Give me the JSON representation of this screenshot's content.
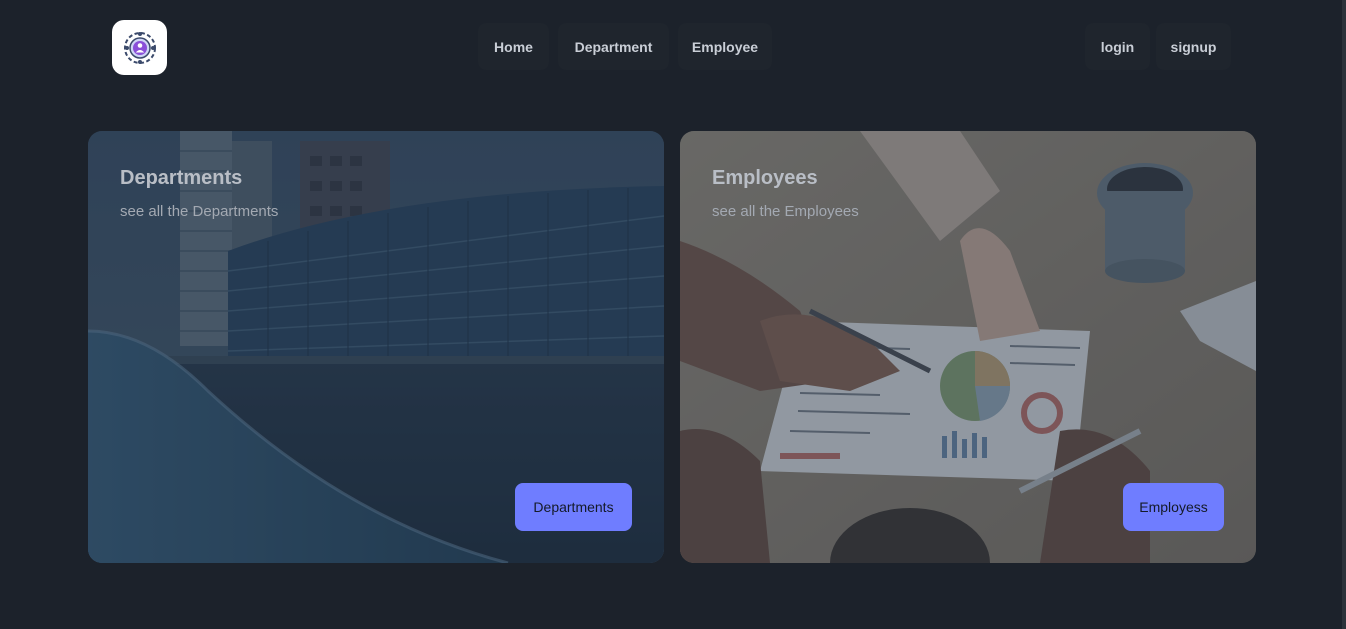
{
  "header": {
    "logo_icon": "gear-people-logo-icon",
    "nav": [
      {
        "label": "Home"
      },
      {
        "label": "Department"
      },
      {
        "label": "Employee"
      }
    ],
    "auth": {
      "login_label": "login",
      "signup_label": "signup"
    }
  },
  "cards": [
    {
      "title": "Departments",
      "subtitle": "see all the Departments",
      "button_label": "Departments",
      "image": "office-building-by-water"
    },
    {
      "title": "Employees",
      "subtitle": "see all the Employees",
      "button_label": "Employess",
      "image": "people-reviewing-charts-at-table"
    }
  ],
  "colors": {
    "background": "#1c222b",
    "nav_button": "#1f252d",
    "accent_button": "#6f7dff"
  }
}
